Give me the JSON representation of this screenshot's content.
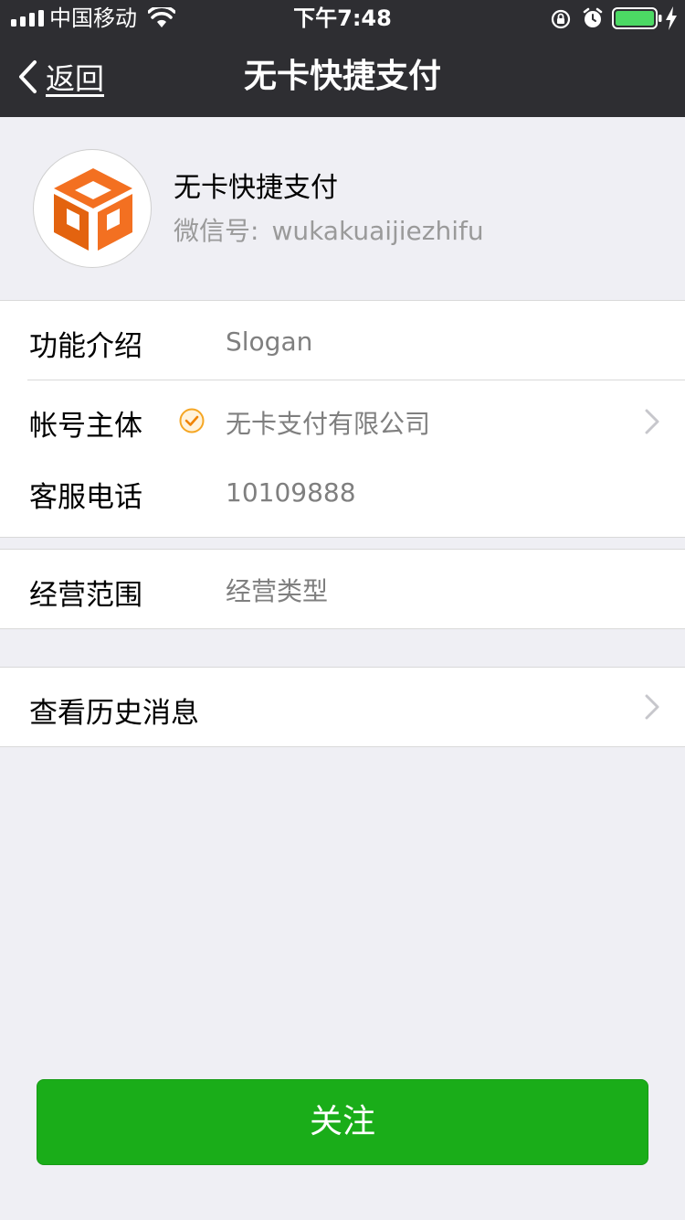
{
  "status_bar": {
    "carrier": "中国移动",
    "time": "下午7:48",
    "icons": [
      "signal-icon",
      "wifi-icon",
      "rotation-lock-icon",
      "alarm-icon",
      "battery-icon",
      "charging-icon"
    ],
    "battery_color": "#4cd964"
  },
  "nav": {
    "back_label": "返回",
    "title": "无卡快捷支付",
    "background": "#2e2e32"
  },
  "profile": {
    "name": "无卡快捷支付",
    "wechat_id_label": "微信号:",
    "wechat_id": "wukakuaijiezhifu",
    "logo_colors": [
      "#f37021",
      "#e3630f"
    ]
  },
  "info": {
    "intro_label": "功能介绍",
    "intro_value": "Slogan",
    "account_label": "帐号主体",
    "account_value": "无卡支付有限公司",
    "phone_label": "客服电话",
    "phone_value": "10109888",
    "scope_label": "经营范围",
    "scope_value": "经营类型",
    "history_label": "查看历史消息"
  },
  "actions": {
    "follow_label": "关注",
    "follow_color": "#1aad19"
  }
}
